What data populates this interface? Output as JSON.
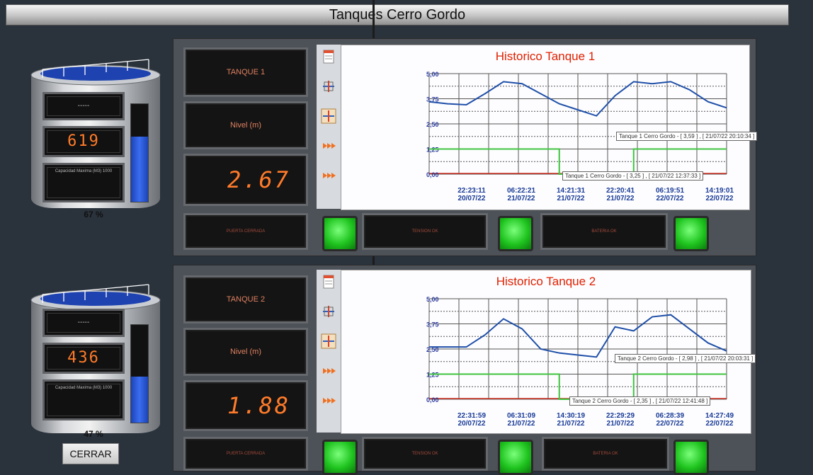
{
  "window": {
    "title": "Tanques Cerro Gordo"
  },
  "colors": {
    "accent_led": "#ff7b2a",
    "green_led": "#1fc41f",
    "line_level": "#1f4fa8",
    "line_pump": "#3ec43e",
    "line_limit": "#d03020"
  },
  "tanks": [
    {
      "status_text": "-----",
      "volume_display": "619",
      "capacity_label": "Capacidad Maxima (M3) 1000",
      "percent": "67 %",
      "fill_fraction": 0.67,
      "name_label": "TANQUE 1",
      "level_label": "Nivel (m)",
      "level_value": "2.67",
      "status_panels": [
        {
          "label": "PUERTA CERRADA"
        },
        {
          "label": "TENSION OK"
        },
        {
          "label": "BATERIA OK"
        }
      ],
      "chart_title": "Historico Tanque 1",
      "yticks": [
        "5,00",
        "3,75",
        "2,50",
        "1,25",
        "0,00"
      ],
      "xticks": [
        {
          "time": "22:23:11",
          "date": "20/07/22"
        },
        {
          "time": "06:22:21",
          "date": "21/07/22"
        },
        {
          "time": "14:21:31",
          "date": "21/07/22"
        },
        {
          "time": "22:20:41",
          "date": "21/07/22"
        },
        {
          "time": "06:19:51",
          "date": "22/07/22"
        },
        {
          "time": "14:19:01",
          "date": "22/07/22"
        }
      ],
      "tooltip_a": "Tanque 1 Cerro Gordo - [ 3,59 ] , [ 21/07/22 20:10:34 ]",
      "tooltip_b": "Tanque 1 Cerro Gordo - [ 3,25 ] , [ 21/07/22 12:37:33 ]"
    },
    {
      "status_text": "-----",
      "volume_display": "436",
      "capacity_label": "Capacidad Maxima (M3) 1000",
      "percent": "47 %",
      "fill_fraction": 0.47,
      "name_label": "TANQUE 2",
      "level_label": "Nivel (m)",
      "level_value": "1.88",
      "status_panels": [
        {
          "label": "PUERTA CERRADA"
        },
        {
          "label": "TENSION OK"
        },
        {
          "label": "BATERIA OK"
        }
      ],
      "chart_title": "Historico Tanque 2",
      "yticks": [
        "5,00",
        "3,75",
        "2,50",
        "1,25",
        "0,00"
      ],
      "xticks": [
        {
          "time": "22:31:59",
          "date": "20/07/22"
        },
        {
          "time": "06:31:09",
          "date": "21/07/22"
        },
        {
          "time": "14:30:19",
          "date": "21/07/22"
        },
        {
          "time": "22:29:29",
          "date": "21/07/22"
        },
        {
          "time": "06:28:39",
          "date": "22/07/22"
        },
        {
          "time": "14:27:49",
          "date": "22/07/22"
        }
      ],
      "tooltip_a": "Tanque 2 Cerro Gordo - [ 2,98 ] , [ 21/07/22 20:03:31 ]",
      "tooltip_b": "Tanque 2 Cerro Gordo - [ 2,35 ] , [ 21/07/22 12:41:48 ]"
    }
  ],
  "close_button": "CERRAR",
  "chart_data": [
    {
      "type": "line",
      "title": "Historico Tanque 1",
      "ylim": [
        0,
        5
      ],
      "x": [
        0,
        1,
        2,
        3,
        4,
        5,
        6
      ],
      "series": [
        {
          "values": [
            3.6,
            3.5,
            3.45,
            4.0,
            4.6,
            4.5,
            4.0,
            3.5,
            3.2,
            2.9,
            3.9,
            4.6,
            4.5,
            4.6,
            4.2,
            3.6,
            3.3
          ]
        },
        {
          "values": [
            1.25,
            1.25,
            1.25,
            1.25,
            1.25,
            1.25,
            1.25,
            0,
            0,
            0,
            0,
            1.25,
            1.25,
            1.25,
            1.25,
            1.25,
            1.25
          ]
        }
      ]
    },
    {
      "type": "line",
      "title": "Historico Tanque 2",
      "ylim": [
        0,
        5
      ],
      "x": [
        0,
        1,
        2,
        3,
        4,
        5,
        6
      ],
      "series": [
        {
          "values": [
            2.6,
            2.6,
            2.6,
            3.2,
            4.0,
            3.5,
            2.5,
            2.3,
            2.2,
            2.1,
            3.6,
            3.4,
            4.1,
            4.2,
            3.5,
            2.8,
            2.4
          ]
        },
        {
          "values": [
            1.25,
            1.25,
            1.25,
            1.25,
            1.25,
            1.25,
            1.25,
            0,
            0,
            0,
            0,
            1.25,
            1.25,
            1.25,
            1.25,
            1.25,
            1.25
          ]
        }
      ]
    }
  ]
}
